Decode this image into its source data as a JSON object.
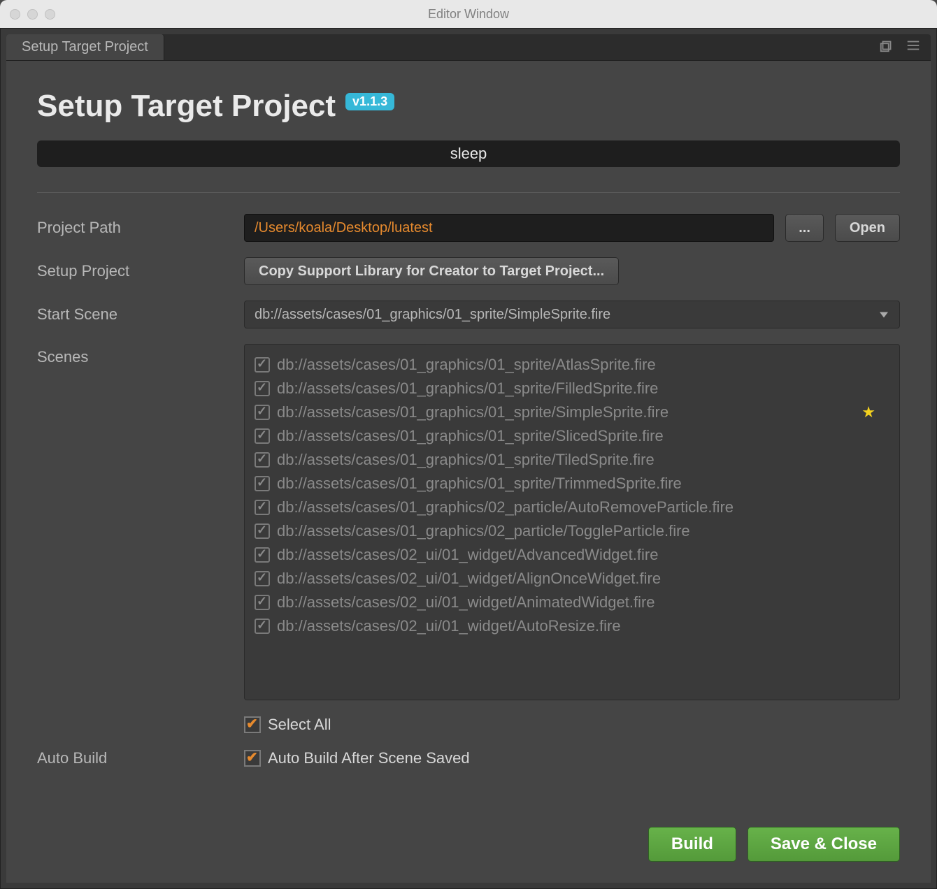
{
  "window": {
    "title": "Editor Window"
  },
  "tab": {
    "label": "Setup Target Project"
  },
  "page": {
    "title": "Setup Target Project",
    "version": "v1.1.3"
  },
  "status": {
    "text": "sleep"
  },
  "labels": {
    "project_path": "Project Path",
    "setup_project": "Setup Project",
    "start_scene": "Start Scene",
    "scenes": "Scenes",
    "auto_build": "Auto Build"
  },
  "project_path": {
    "value": "/Users/koala/Desktop/luatest"
  },
  "buttons": {
    "browse": "...",
    "open": "Open",
    "copy_support": "Copy Support Library for Creator to Target Project...",
    "build": "Build",
    "save_close": "Save & Close"
  },
  "start_scene": {
    "selected": "db://assets/cases/01_graphics/01_sprite/SimpleSprite.fire"
  },
  "scenes": {
    "items": [
      {
        "path": "db://assets/cases/01_graphics/01_sprite/AtlasSprite.fire",
        "checked": true,
        "star": false
      },
      {
        "path": "db://assets/cases/01_graphics/01_sprite/FilledSprite.fire",
        "checked": true,
        "star": false
      },
      {
        "path": "db://assets/cases/01_graphics/01_sprite/SimpleSprite.fire",
        "checked": true,
        "star": true
      },
      {
        "path": "db://assets/cases/01_graphics/01_sprite/SlicedSprite.fire",
        "checked": true,
        "star": false
      },
      {
        "path": "db://assets/cases/01_graphics/01_sprite/TiledSprite.fire",
        "checked": true,
        "star": false
      },
      {
        "path": "db://assets/cases/01_graphics/01_sprite/TrimmedSprite.fire",
        "checked": true,
        "star": false
      },
      {
        "path": "db://assets/cases/01_graphics/02_particle/AutoRemoveParticle.fire",
        "checked": true,
        "star": false
      },
      {
        "path": "db://assets/cases/01_graphics/02_particle/ToggleParticle.fire",
        "checked": true,
        "star": false
      },
      {
        "path": "db://assets/cases/02_ui/01_widget/AdvancedWidget.fire",
        "checked": true,
        "star": false
      },
      {
        "path": "db://assets/cases/02_ui/01_widget/AlignOnceWidget.fire",
        "checked": true,
        "star": false
      },
      {
        "path": "db://assets/cases/02_ui/01_widget/AnimatedWidget.fire",
        "checked": true,
        "star": false
      },
      {
        "path": "db://assets/cases/02_ui/01_widget/AutoResize.fire",
        "checked": true,
        "star": false
      }
    ]
  },
  "select_all": {
    "label": "Select All",
    "checked": true
  },
  "auto_build": {
    "label": "Auto Build After Scene Saved",
    "checked": true
  }
}
